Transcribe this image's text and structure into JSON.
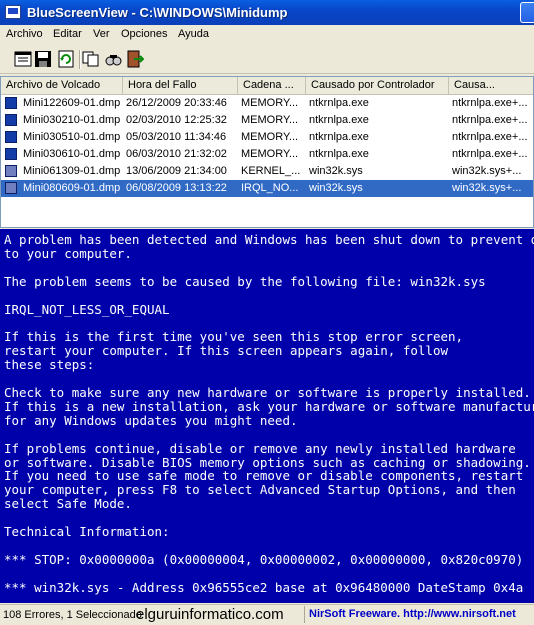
{
  "window": {
    "title": "BlueScreenView   -   C:\\WINDOWS\\Minidump"
  },
  "menu": [
    "Archivo",
    "Editar",
    "Ver",
    "Opciones",
    "Ayuda"
  ],
  "toolbar_icons": [
    "properties-icon",
    "save-icon",
    "refresh-icon",
    "copy-icon",
    "search-icon",
    "exit-icon"
  ],
  "list": {
    "columns": [
      "Archivo de Volcado",
      "Hora del Fallo",
      "Cadena ...",
      "Causado por Controlador",
      "Causa..."
    ],
    "rows": [
      [
        "Mini122609-01.dmp",
        "26/12/2009 20:33:46",
        "MEMORY...",
        "ntkrnlpa.exe",
        "ntkrnlpa.exe+..."
      ],
      [
        "Mini030210-01.dmp",
        "02/03/2010 12:25:32",
        "MEMORY...",
        "ntkrnlpa.exe",
        "ntkrnlpa.exe+..."
      ],
      [
        "Mini030510-01.dmp",
        "05/03/2010 11:34:46",
        "MEMORY...",
        "ntkrnlpa.exe",
        "ntkrnlpa.exe+..."
      ],
      [
        "Mini030610-01.dmp",
        "06/03/2010 21:32:02",
        "MEMORY...",
        "ntkrnlpa.exe",
        "ntkrnlpa.exe+..."
      ],
      [
        "Mini061309-01.dmp",
        "13/06/2009 21:34:00",
        "KERNEL_...",
        "win32k.sys",
        "win32k.sys+..."
      ],
      [
        "Mini080609-01.dmp",
        "06/08/2009 13:13:22",
        "IRQL_NO...",
        "win32k.sys",
        "win32k.sys+..."
      ]
    ],
    "selected_row": 5
  },
  "bsod": {
    "text": "A problem has been detected and Windows has been shut down to prevent damage\nto your computer.\n\nThe problem seems to be caused by the following file: win32k.sys\n\nIRQL_NOT_LESS_OR_EQUAL\n\nIf this is the first time you've seen this stop error screen,\nrestart your computer. If this screen appears again, follow\nthese steps:\n\nCheck to make sure any new hardware or software is properly installed.\nIf this is a new installation, ask your hardware or software manufacturer\nfor any Windows updates you might need.\n\nIf problems continue, disable or remove any newly installed hardware\nor software. Disable BIOS memory options such as caching or shadowing.\nIf you need to use safe mode to remove or disable components, restart\nyour computer, press F8 to select Advanced Startup Options, and then\nselect Safe Mode.\n\nTechnical Information:\n\n*** STOP: 0x0000000a (0x00000004, 0x00000002, 0x00000000, 0x820c0970)\n\n*** win32k.sys - Address 0x96555ce2 base at 0x96480000 DateStamp 0x4a"
  },
  "status": {
    "count": "108 Errores, 1 Seleccionado",
    "brand": "elguruinformatico.com",
    "nirsoft": "NirSoft Freeware.  http://www.nirsoft.net"
  },
  "colors": {
    "bsod_background": "#0000aa",
    "selection": "#316ac5",
    "title_bar": "#0a52d8"
  }
}
